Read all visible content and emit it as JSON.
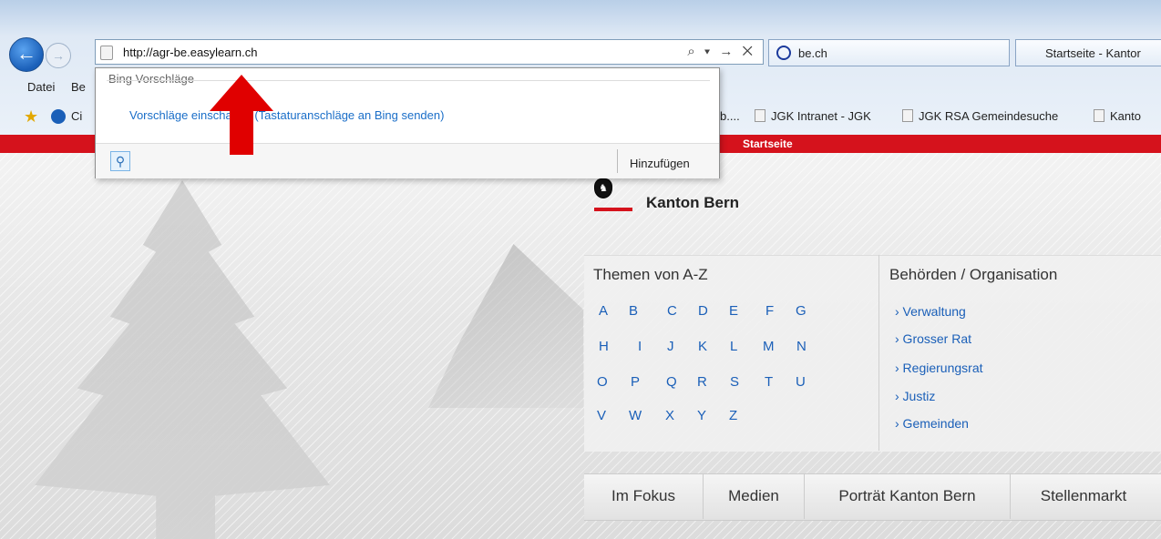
{
  "browser": {
    "address_url": "http://agr-be.easylearn.ch",
    "address_tools": "⌕ ▾ → ✕",
    "tabs": [
      {
        "label": "be.ch"
      },
      {
        "label": "Startseite - Kantor"
      }
    ],
    "menu": [
      "Datei",
      "Be"
    ],
    "favorites": {
      "first_label": "Ci",
      "partial_label": "b....",
      "items": [
        "JGK Intranet - JGK",
        "JGK RSA Gemeindesuche",
        "Kanto"
      ]
    },
    "redbar_label": "Startseite"
  },
  "suggestions": {
    "title": "Bing Vorschläge",
    "link": "Vorschläge einschalten (Tastaturanschläge an Bing senden)",
    "add_label": "Hinzufügen"
  },
  "page": {
    "logo_text": "Kanton Bern",
    "themen_title": "Themen von A-Z",
    "letters": [
      [
        "A",
        "B",
        "C",
        "D",
        "E",
        "F",
        "G"
      ],
      [
        "H",
        "I",
        "J",
        "K",
        "L",
        "M",
        "N"
      ],
      [
        "O",
        "P",
        "Q",
        "R",
        "S",
        "T",
        "U"
      ],
      [
        "V",
        "W",
        "X",
        "Y",
        "Z"
      ]
    ],
    "behoerden_title": "Behörden / Organisation",
    "behoerden_links": [
      "› Verwaltung",
      "› Grosser Rat",
      "› Regierungsrat",
      "› Justiz",
      "› Gemeinden"
    ],
    "nav_tabs": [
      "Im Fokus",
      "Medien",
      "Porträt Kanton Bern",
      "Stellenmarkt"
    ]
  },
  "colors": {
    "accent_red": "#d5121c",
    "link_blue": "#1a5fb8",
    "annotation_arrow": "#e00000"
  }
}
